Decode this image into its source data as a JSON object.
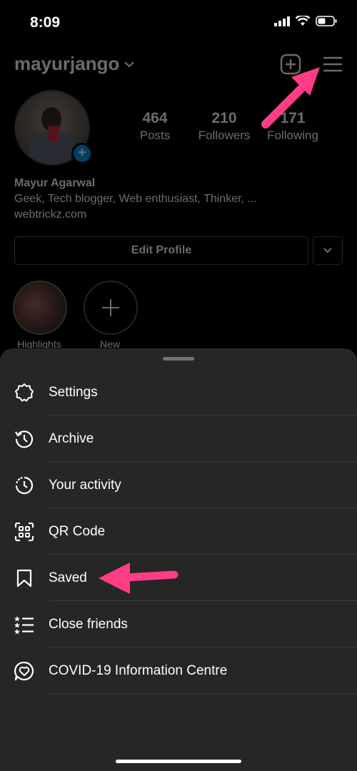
{
  "status": {
    "time": "8:09"
  },
  "profile": {
    "username": "mayurjango",
    "stats": [
      {
        "value": "464",
        "label": "Posts"
      },
      {
        "value": "210",
        "label": "Followers"
      },
      {
        "value": "171",
        "label": "Following"
      }
    ],
    "name": "Mayur Agarwal",
    "bio": "Geek, Tech blogger, Web enthusiast, Thinker, ...",
    "website": "webtrickz.com",
    "edit_profile_label": "Edit Profile",
    "highlights": [
      {
        "label": "Highlights"
      },
      {
        "label": "New"
      }
    ]
  },
  "menu": {
    "items": [
      {
        "label": "Settings",
        "icon": "settings-icon"
      },
      {
        "label": "Archive",
        "icon": "archive-icon"
      },
      {
        "label": "Your activity",
        "icon": "activity-icon"
      },
      {
        "label": "QR Code",
        "icon": "qr-code-icon"
      },
      {
        "label": "Saved",
        "icon": "bookmark-icon"
      },
      {
        "label": "Close friends",
        "icon": "close-friends-icon"
      },
      {
        "label": "COVID-19 Information Centre",
        "icon": "covid-info-icon"
      }
    ]
  },
  "colors": {
    "annotation_arrow": "#ff3d87",
    "sheet_bg": "#262626",
    "accent_blue": "#0095f6"
  }
}
